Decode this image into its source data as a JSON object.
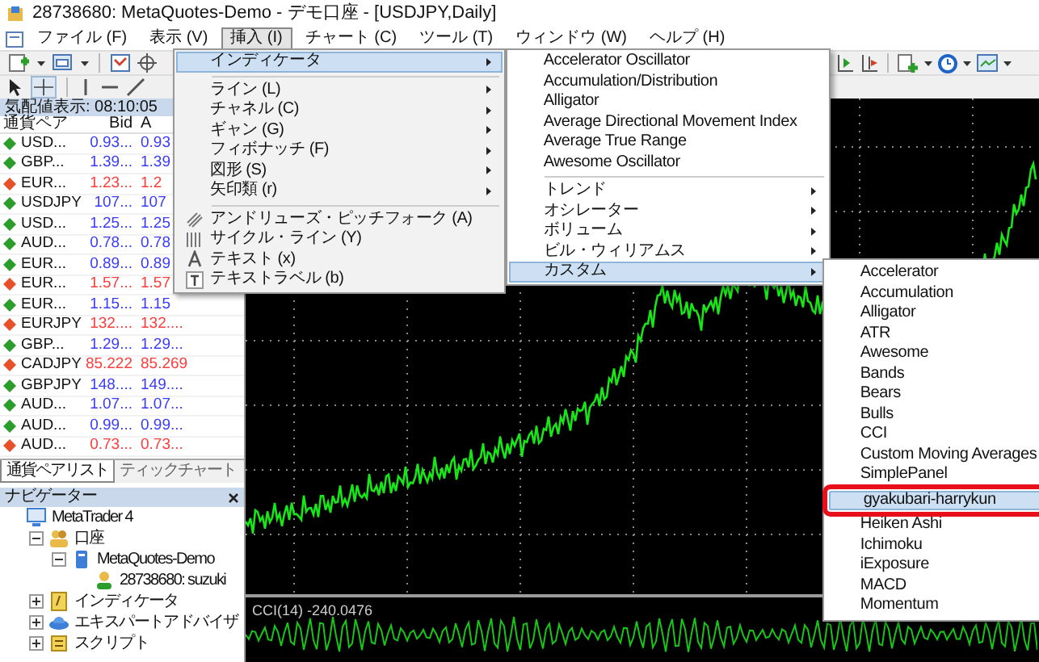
{
  "window": {
    "title": "28738680: MetaQuotes-Demo - デモ口座 - [USDJPY,Daily]"
  },
  "menubar": [
    {
      "label": "ファイル (F)",
      "selected": false
    },
    {
      "label": "表示 (V)",
      "selected": false
    },
    {
      "label": "挿入 (I)",
      "selected": true
    },
    {
      "label": "チャート (C)",
      "selected": false
    },
    {
      "label": "ツール (T)",
      "selected": false
    },
    {
      "label": "ウィンドウ (W)",
      "selected": false
    },
    {
      "label": "ヘルプ (H)",
      "selected": false
    }
  ],
  "market_watch": {
    "title": "気配値表示: 08:10:05",
    "columns": [
      "通貨ペア",
      "Bid",
      "A"
    ],
    "rows": [
      {
        "symbol": "USD...",
        "bid": "0.93...",
        "ask": "0.93",
        "color": "#2a9d2a"
      },
      {
        "symbol": "GBP...",
        "bid": "1.39...",
        "ask": "1.39",
        "color": "#2a9d2a"
      },
      {
        "symbol": "EUR...",
        "bid": "1.23...",
        "ask": "1.2",
        "color": "#e8502a"
      },
      {
        "symbol": "USDJPY",
        "bid": "107...",
        "ask": "107",
        "color": "#2a9d2a"
      },
      {
        "symbol": "USD...",
        "bid": "1.25...",
        "ask": "1.25",
        "color": "#2a9d2a"
      },
      {
        "symbol": "AUD...",
        "bid": "0.78...",
        "ask": "0.78",
        "color": "#2a9d2a"
      },
      {
        "symbol": "EUR...",
        "bid": "0.89...",
        "ask": "0.89",
        "color": "#2a9d2a"
      },
      {
        "symbol": "EUR...",
        "bid": "1.57...",
        "ask": "1.57",
        "color": "#e8502a"
      },
      {
        "symbol": "EUR...",
        "bid": "1.15...",
        "ask": "1.15",
        "color": "#2a9d2a"
      },
      {
        "symbol": "EURJPY",
        "bid": "132....",
        "ask": "132....",
        "color": "#e8502a"
      },
      {
        "symbol": "GBP...",
        "bid": "1.29...",
        "ask": "1.29...",
        "color": "#2a9d2a"
      },
      {
        "symbol": "CADJPY",
        "bid": "85.222",
        "ask": "85.269",
        "color": "#e8502a"
      },
      {
        "symbol": "GBPJPY",
        "bid": "148....",
        "ask": "149....",
        "color": "#2a9d2a"
      },
      {
        "symbol": "AUD...",
        "bid": "1.07...",
        "ask": "1.07...",
        "color": "#2a9d2a"
      },
      {
        "symbol": "AUD...",
        "bid": "0.99...",
        "ask": "0.99...",
        "color": "#2a9d2a"
      },
      {
        "symbol": "AUD...",
        "bid": "0.73...",
        "ask": "0.73...",
        "color": "#e8502a"
      }
    ]
  },
  "tabs": [
    {
      "label": "通貨ペアリスト",
      "selected": true
    },
    {
      "label": "ティックチャート",
      "selected": false
    }
  ],
  "navigator": {
    "title": "ナビゲーター",
    "tree": [
      {
        "label": "MetaTrader 4",
        "kind": "terminal",
        "children": [
          {
            "label": "口座",
            "kind": "accounts",
            "expanded": true,
            "children": [
              {
                "label": "MetaQuotes-Demo",
                "kind": "server",
                "expanded": true,
                "children": [
                  {
                    "label": "28738680: suzuki",
                    "kind": "account"
                  }
                ]
              }
            ]
          },
          {
            "label": "インディケータ",
            "kind": "indicators",
            "expanded": false
          },
          {
            "label": "エキスパートアドバイザ",
            "kind": "experts",
            "expanded": false
          },
          {
            "label": "スクリプト",
            "kind": "scripts",
            "expanded": false
          }
        ]
      }
    ]
  },
  "chart": {
    "subwindow_label": "CCI(14) -240.0476"
  },
  "insert_menu": [
    {
      "label": "インディケータ",
      "kind": "submenu",
      "selected": true
    },
    {
      "kind": "separator"
    },
    {
      "label": "ライン (L)",
      "kind": "submenu",
      "selected": false
    },
    {
      "label": "チャネル (C)",
      "kind": "submenu",
      "selected": false
    },
    {
      "label": "ギャン (G)",
      "kind": "submenu",
      "selected": false
    },
    {
      "label": "フィボナッチ (F)",
      "kind": "submenu",
      "selected": false
    },
    {
      "label": "図形 (S)",
      "kind": "submenu",
      "selected": false
    },
    {
      "label": "矢印類 (r)",
      "kind": "submenu",
      "selected": false
    },
    {
      "kind": "separator"
    },
    {
      "label": "アンドリューズ・ピッチフォーク (A)",
      "kind": "pitchfork",
      "selected": false
    },
    {
      "label": "サイクル・ライン (Y)",
      "kind": "cycles",
      "selected": false
    },
    {
      "label": "テキスト (x)",
      "kind": "text",
      "selected": false
    },
    {
      "label": "テキストラベル (b)",
      "kind": "textlabel",
      "selected": false
    }
  ],
  "indicator_menu": [
    {
      "label": "Accelerator Oscillator",
      "kind": "item",
      "selected": false
    },
    {
      "label": "Accumulation/Distribution",
      "kind": "item",
      "selected": false
    },
    {
      "label": "Alligator",
      "kind": "item",
      "selected": false
    },
    {
      "label": "Average Directional Movement Index",
      "kind": "item",
      "selected": false
    },
    {
      "label": "Average True Range",
      "kind": "item",
      "selected": false
    },
    {
      "label": "Awesome Oscillator",
      "kind": "item",
      "selected": false
    },
    {
      "kind": "separator"
    },
    {
      "label": "トレンド",
      "kind": "submenu",
      "selected": false
    },
    {
      "label": "オシレーター",
      "kind": "submenu",
      "selected": false
    },
    {
      "label": "ボリューム",
      "kind": "submenu",
      "selected": false
    },
    {
      "label": "ビル・ウィリアムス",
      "kind": "submenu",
      "selected": false
    },
    {
      "label": "カスタム",
      "kind": "submenu",
      "selected": true
    }
  ],
  "custom_menu": [
    {
      "label": "Accelerator",
      "selected": false,
      "outlined": false
    },
    {
      "label": "Accumulation",
      "selected": false,
      "outlined": false
    },
    {
      "label": "Alligator",
      "selected": false,
      "outlined": false
    },
    {
      "label": "ATR",
      "selected": false,
      "outlined": false
    },
    {
      "label": "Awesome",
      "selected": false,
      "outlined": false
    },
    {
      "label": "Bands",
      "selected": false,
      "outlined": false
    },
    {
      "label": "Bears",
      "selected": false,
      "outlined": false
    },
    {
      "label": "Bulls",
      "selected": false,
      "outlined": false
    },
    {
      "label": "CCI",
      "selected": false,
      "outlined": false
    },
    {
      "label": "Custom Moving Averages",
      "selected": false,
      "outlined": false
    },
    {
      "label": "SimplePanel",
      "selected": false,
      "outlined": false
    },
    {
      "label": "gyakubari-harrykun",
      "selected": true,
      "outlined": true
    },
    {
      "label": "Heiken Ashi",
      "selected": false,
      "outlined": false
    },
    {
      "label": "Ichimoku",
      "selected": false,
      "outlined": false
    },
    {
      "label": "iExposure",
      "selected": false,
      "outlined": false
    },
    {
      "label": "MACD",
      "selected": false,
      "outlined": false
    },
    {
      "label": "Momentum",
      "selected": false,
      "outlined": false
    }
  ]
}
